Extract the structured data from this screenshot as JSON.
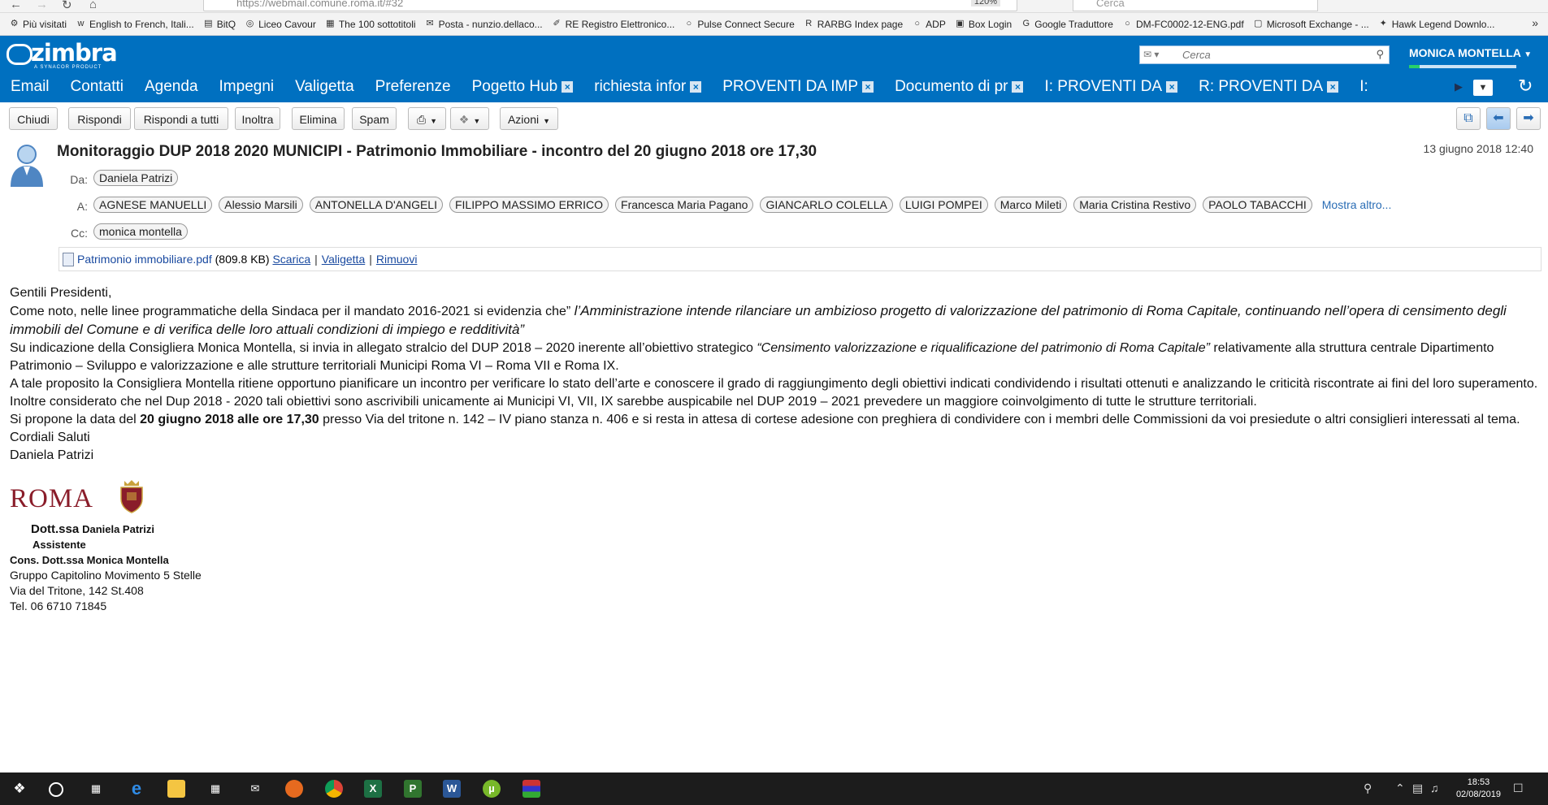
{
  "browser": {
    "url": "https://webmail.comune.roma.it/#32",
    "zoom": "120%",
    "search_placeholder": "Cerca",
    "bookmarks": [
      {
        "label": "Più visitati",
        "icon": "gear-icon"
      },
      {
        "label": "English to French, Itali...",
        "icon": "wordreference-icon"
      },
      {
        "label": "BitQ",
        "icon": "bitq-icon"
      },
      {
        "label": "Liceo Cavour",
        "icon": "school-icon"
      },
      {
        "label": "The 100 sottotitoli",
        "icon": "subtitles-icon"
      },
      {
        "label": "Posta - nunzio.dellaco...",
        "icon": "outlook-icon"
      },
      {
        "label": "RE Registro Elettronico...",
        "icon": "registro-icon"
      },
      {
        "label": "Pulse Connect Secure",
        "icon": "globe-icon"
      },
      {
        "label": "RARBG Index page",
        "icon": "rarbg-icon"
      },
      {
        "label": "ADP",
        "icon": "globe-icon"
      },
      {
        "label": "Box Login",
        "icon": "box-icon"
      },
      {
        "label": "Google Traduttore",
        "icon": "translate-icon"
      },
      {
        "label": "DM-FC0002-12-ENG.pdf",
        "icon": "globe-icon"
      },
      {
        "label": "Microsoft Exchange - ...",
        "icon": "exchange-icon"
      },
      {
        "label": "Hawk Legend Downlo...",
        "icon": "hawk-icon"
      }
    ]
  },
  "zimbra": {
    "logo_text": "zimbra",
    "logo_sub": "A SYNACOR PRODUCT",
    "search_placeholder": "Cerca",
    "user_name": "MONICA MONTELLA",
    "quota_fraction": 0.1
  },
  "tabs": [
    {
      "label": "Email",
      "closable": false
    },
    {
      "label": "Contatti",
      "closable": false
    },
    {
      "label": "Agenda",
      "closable": false
    },
    {
      "label": "Impegni",
      "closable": false
    },
    {
      "label": "Valigetta",
      "closable": false
    },
    {
      "label": "Preferenze",
      "closable": false
    },
    {
      "label": "Pogetto Hub",
      "closable": true
    },
    {
      "label": "richiesta infor",
      "closable": true
    },
    {
      "label": "PROVENTI DA IMP",
      "closable": true
    },
    {
      "label": "Documento di pr",
      "closable": true
    },
    {
      "label": "I: PROVENTI DA",
      "closable": true
    },
    {
      "label": "R: PROVENTI DA",
      "closable": true
    },
    {
      "label": "I:",
      "closable": false
    }
  ],
  "toolbar": {
    "close": "Chiudi",
    "reply": "Rispondi",
    "reply_all": "Rispondi a tutti",
    "forward": "Inoltra",
    "delete": "Elimina",
    "spam": "Spam",
    "actions": "Azioni"
  },
  "message": {
    "subject": "Monitoraggio DUP 2018 2020 MUNICIPI - Patrimonio Immobiliare - incontro del 20 giugno 2018 ore 17,30",
    "date": "13 giugno 2018 12:40",
    "from_label": "Da:",
    "to_label": "A:",
    "cc_label": "Cc:",
    "from": "Daniela Patrizi",
    "to": [
      "AGNESE MANUELLI",
      "Alessio Marsili",
      "ANTONELLA D'ANGELI",
      "FILIPPO MASSIMO ERRICO",
      "Francesca Maria Pagano",
      "GIANCARLO COLELLA",
      "LUIGI POMPEI",
      "Marco Mileti",
      "Maria Cristina Restivo",
      "PAOLO TABACCHI"
    ],
    "show_more": "Mostra altro...",
    "cc": [
      "monica montella"
    ],
    "attachment": {
      "name": "Patrimonio immobiliare.pdf",
      "size": "(809.8 KB)",
      "download": "Scarica",
      "briefcase": "Valigetta",
      "remove": "Rimuovi",
      "sep": "|"
    },
    "body": {
      "greeting": "Gentili Presidenti,",
      "p1_a": "Come noto, nelle linee programmatiche della Sindaca per il mandato 2016-2021 si evidenzia che” ",
      "p1_b": "l’Amministrazione intende rilanciare un ambizioso progetto di valorizzazione del patrimonio di Roma Capitale, continuando nell’opera di censimento degli immobili del Comune e di verifica delle loro attuali condizioni di impiego e redditività”",
      "p2_a": "Su indicazione della Consigliera Monica Montella, si invia in allegato stralcio del DUP 2018 – 2020 inerente all’obiettivo strategico ",
      "p2_b": "“Censimento valorizzazione e riqualificazione del patrimonio di Roma Capitale”",
      "p2_c": "  relativamente alla struttura centrale  Dipartimento Patrimonio – Sviluppo e valorizzazione e alle strutture territoriali Municipi Roma VI – Roma VII e Roma IX.",
      "p3": "A tale proposito la Consigliera Montella ritiene opportuno pianificare un incontro per verificare lo stato dell’arte e conoscere il grado di raggiungimento degli obiettivi indicati condividendo i risultati ottenuti e  analizzando le criticità riscontrate ai fini del loro superamento. Inoltre considerato che nel Dup 2018 - 2020  tali obiettivi sono ascrivibili unicamente ai Municipi VI, VII, IX sarebbe auspicabile nel DUP 2019 – 2021 prevedere un maggiore coinvolgimento di tutte le strutture territoriali.",
      "p4_a": "Si propone la data del  ",
      "p4_b": "20 giugno 2018 alle ore 17,30",
      "p4_c": "  presso Via del tritone n. 142 – IV piano stanza n. 406  e si resta in attesa  di cortese adesione con preghiera di condividere con i membri delle Commissioni da voi presiedute o altri consiglieri interessati al tema.",
      "closing": "Cordiali Saluti",
      "sender": "Daniela Patrizi"
    },
    "signature": {
      "logo_text": "ROMA",
      "title_prefix": "Dott.ssa",
      "name": "Daniela Patrizi",
      "role": "Assistente",
      "councillor": "Cons. Dott.ssa Monica Montella",
      "group": "Gruppo Capitolino Movimento 5 Stelle",
      "address": "Via del Tritone, 142 St.408",
      "phone": "Tel. 06 6710 71845"
    }
  },
  "taskbar": {
    "time": "18:53",
    "date": "02/08/2019",
    "apps": [
      "start-icon",
      "cortana-icon",
      "task-view-icon",
      "edge-icon",
      "file-explorer-icon",
      "store-icon",
      "mail-icon",
      "firefox-icon",
      "chrome-icon",
      "excel-icon",
      "project-icon",
      "word-icon",
      "utorrent-icon",
      "media-icon"
    ]
  }
}
